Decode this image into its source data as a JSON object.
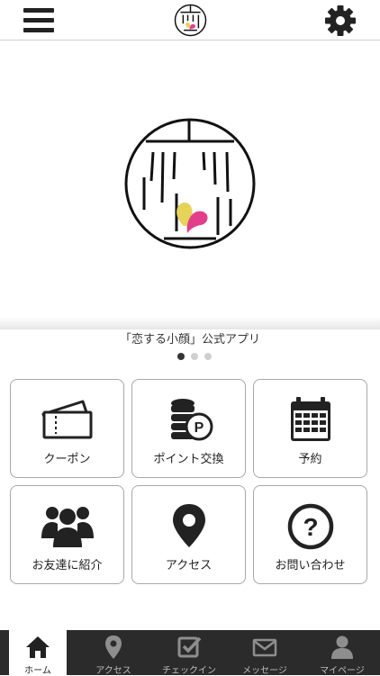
{
  "header": {
    "menu_icon": "hamburger-menu-icon",
    "settings_icon": "gear-icon",
    "logo": "shop-logo"
  },
  "hero": {
    "caption": "「恋する小顔」公式アプリ",
    "slide_count": 3,
    "active_slide": 1
  },
  "tiles": [
    {
      "label": "クーポン",
      "icon": "ticket-icon"
    },
    {
      "label": "ポイント交換",
      "icon": "points-coins-icon"
    },
    {
      "label": "予約",
      "icon": "calendar-icon"
    },
    {
      "label": "お友達に紹介",
      "icon": "friends-group-icon"
    },
    {
      "label": "アクセス",
      "icon": "map-pin-icon"
    },
    {
      "label": "お問い合わせ",
      "icon": "question-circle-icon"
    }
  ],
  "tabbar": {
    "items": [
      {
        "label": "ホーム",
        "icon": "home-icon",
        "active": true
      },
      {
        "label": "アクセス",
        "icon": "map-pin-icon",
        "active": false
      },
      {
        "label": "チェックイン",
        "icon": "checkbox-icon",
        "active": false
      },
      {
        "label": "メッセージ",
        "icon": "envelope-icon",
        "active": false
      },
      {
        "label": "マイページ",
        "icon": "user-icon",
        "active": false
      }
    ]
  },
  "colors": {
    "tabbar_bg": "#2b2b2b",
    "tab_active_bg": "#ffffff",
    "logo_heart_yellow": "#e7d35a",
    "logo_heart_pink": "#e23e8c"
  }
}
